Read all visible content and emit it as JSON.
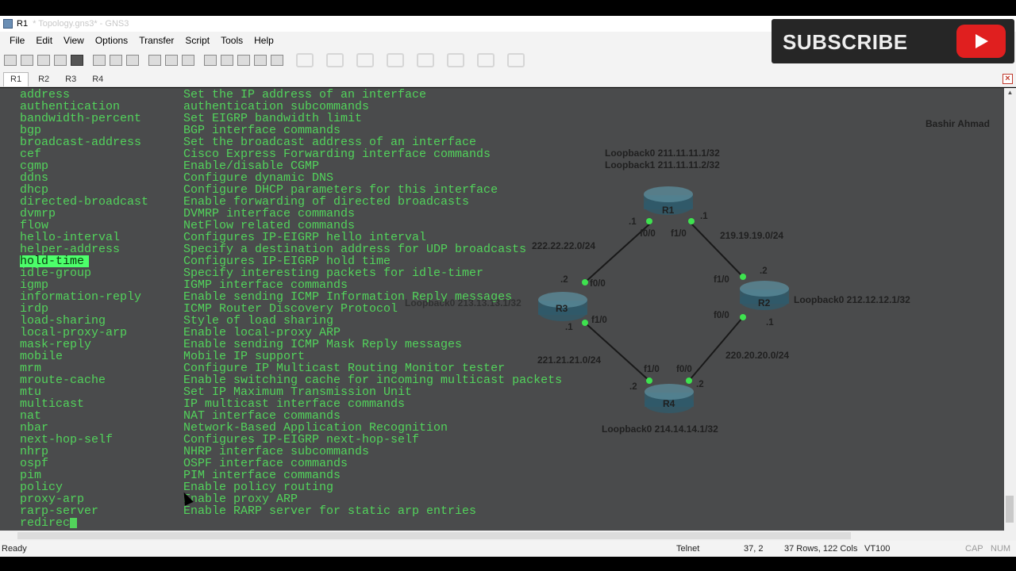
{
  "window": {
    "title": "R1",
    "ghost_title": "* Topology.gns3* - GNS3"
  },
  "menu": [
    "File",
    "Edit",
    "View",
    "Options",
    "Transfer",
    "Script",
    "Tools",
    "Help"
  ],
  "tabs": [
    {
      "label": "R1",
      "active": true
    },
    {
      "label": "R2",
      "active": false
    },
    {
      "label": "R3",
      "active": false
    },
    {
      "label": "R4",
      "active": false
    }
  ],
  "subscribe": {
    "label": "SUBSCRIBE",
    "icon": "play-icon",
    "color": "#e01f1f"
  },
  "terminal": {
    "lines": [
      {
        "cmd": "address",
        "desc": "Set the IP address of an interface"
      },
      {
        "cmd": "authentication",
        "desc": "authentication subcommands"
      },
      {
        "cmd": "bandwidth-percent",
        "desc": "Set EIGRP bandwidth limit"
      },
      {
        "cmd": "bgp",
        "desc": "BGP interface commands"
      },
      {
        "cmd": "broadcast-address",
        "desc": "Set the broadcast address of an interface"
      },
      {
        "cmd": "cef",
        "desc": "Cisco Express Forwarding interface commands"
      },
      {
        "cmd": "cgmp",
        "desc": "Enable/disable CGMP"
      },
      {
        "cmd": "ddns",
        "desc": "Configure dynamic DNS"
      },
      {
        "cmd": "dhcp",
        "desc": "Configure DHCP parameters for this interface"
      },
      {
        "cmd": "directed-broadcast",
        "desc": "Enable forwarding of directed broadcasts"
      },
      {
        "cmd": "dvmrp",
        "desc": "DVMRP interface commands"
      },
      {
        "cmd": "flow",
        "desc": "NetFlow related commands"
      },
      {
        "cmd": "hello-interval",
        "desc": "Configures IP-EIGRP hello interval"
      },
      {
        "cmd": "helper-address",
        "desc": "Specify a destination address for UDP broadcasts"
      },
      {
        "cmd": "hold-time",
        "desc": "Configures IP-EIGRP hold time",
        "highlight": true
      },
      {
        "cmd": "idle-group",
        "desc": "Specify interesting packets for idle-timer"
      },
      {
        "cmd": "igmp",
        "desc": "IGMP interface commands"
      },
      {
        "cmd": "information-reply",
        "desc": "Enable sending ICMP Information Reply messages"
      },
      {
        "cmd": "irdp",
        "desc": "ICMP Router Discovery Protocol"
      },
      {
        "cmd": "load-sharing",
        "desc": "Style of load sharing"
      },
      {
        "cmd": "local-proxy-arp",
        "desc": "Enable local-proxy ARP"
      },
      {
        "cmd": "mask-reply",
        "desc": "Enable sending ICMP Mask Reply messages"
      },
      {
        "cmd": "mobile",
        "desc": "Mobile IP support"
      },
      {
        "cmd": "mrm",
        "desc": "Configure IP Multicast Routing Monitor tester"
      },
      {
        "cmd": "mroute-cache",
        "desc": "Enable switching cache for incoming multicast packets"
      },
      {
        "cmd": "mtu",
        "desc": "Set IP Maximum Transmission Unit"
      },
      {
        "cmd": "multicast",
        "desc": "IP multicast interface commands"
      },
      {
        "cmd": "nat",
        "desc": "NAT interface commands"
      },
      {
        "cmd": "nbar",
        "desc": "Network-Based Application Recognition"
      },
      {
        "cmd": "next-hop-self",
        "desc": "Configures IP-EIGRP next-hop-self"
      },
      {
        "cmd": "nhrp",
        "desc": "NHRP interface subcommands"
      },
      {
        "cmd": "ospf",
        "desc": "OSPF interface commands"
      },
      {
        "cmd": "pim",
        "desc": "PIM interface commands"
      },
      {
        "cmd": "policy",
        "desc": "Enable policy routing"
      },
      {
        "cmd": "proxy-arp",
        "desc": "Enable proxy ARP"
      },
      {
        "cmd": "rarp-server",
        "desc": "Enable RARP server for static arp entries"
      }
    ],
    "prompt": "redirec"
  },
  "topology": {
    "author": "Bashir Ahmad",
    "r1_loopbacks": [
      "Loopback0 211.11.11.1/32",
      "Loopback1 211.11.11.2/32"
    ],
    "r2_loopback": "Loopback0 212.12.12.1/32",
    "r3_loopback": "Loopback0 213.13.13.1/32",
    "r4_loopback": "Loopback0 214.14.14.1/32",
    "routers": [
      "R1",
      "R2",
      "R3",
      "R4"
    ],
    "networks": [
      "222.22.22.0/24",
      "219.19.19.0/24",
      "221.21.21.0/24",
      "220.20.20.0/24"
    ],
    "labels": {
      "r1_f00": "f0/0",
      "r1_f10": "f1/0",
      "r1_left_host": ".1",
      "r1_right_host": ".1",
      "r2_f10": "f1/0",
      "r2_f00": "f0/0",
      "r2_top_host": ".2",
      "r2_bottom_host": ".1",
      "r3_f00": "f0/0",
      "r3_f10": "f1/0",
      "r3_top_host": ".2",
      "r3_bottom_host": ".1",
      "r4_f10": "f1/0",
      "r4_f00": "f0/0",
      "r4_left_host": ".2",
      "r4_right_host": ".2"
    }
  },
  "status": {
    "ready": "Ready",
    "protocol": "Telnet",
    "cursor_pos": "37,  2",
    "size": "37 Rows, 122 Cols",
    "terminal_type": "VT100",
    "cap": "CAP",
    "num": "NUM"
  }
}
